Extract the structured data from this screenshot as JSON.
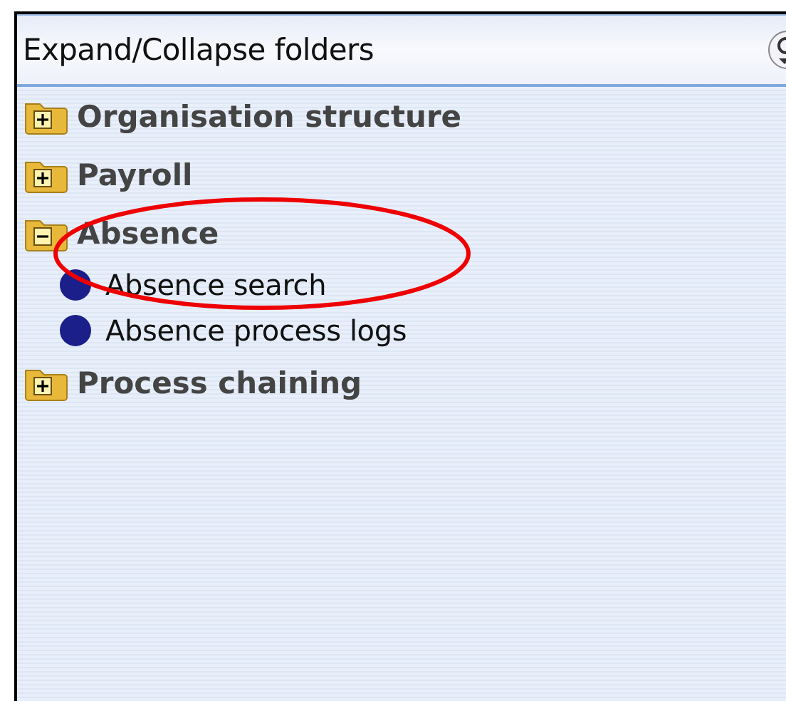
{
  "header": {
    "title": "Expand/Collapse folders"
  },
  "tree": [
    {
      "label": "Organisation structure",
      "expanded": false
    },
    {
      "label": "Payroll",
      "expanded": false
    },
    {
      "label": "Absence",
      "expanded": true,
      "children": [
        {
          "label": "Absence search"
        },
        {
          "label": "Absence process logs"
        }
      ]
    },
    {
      "label": "Process chaining",
      "expanded": false
    }
  ]
}
